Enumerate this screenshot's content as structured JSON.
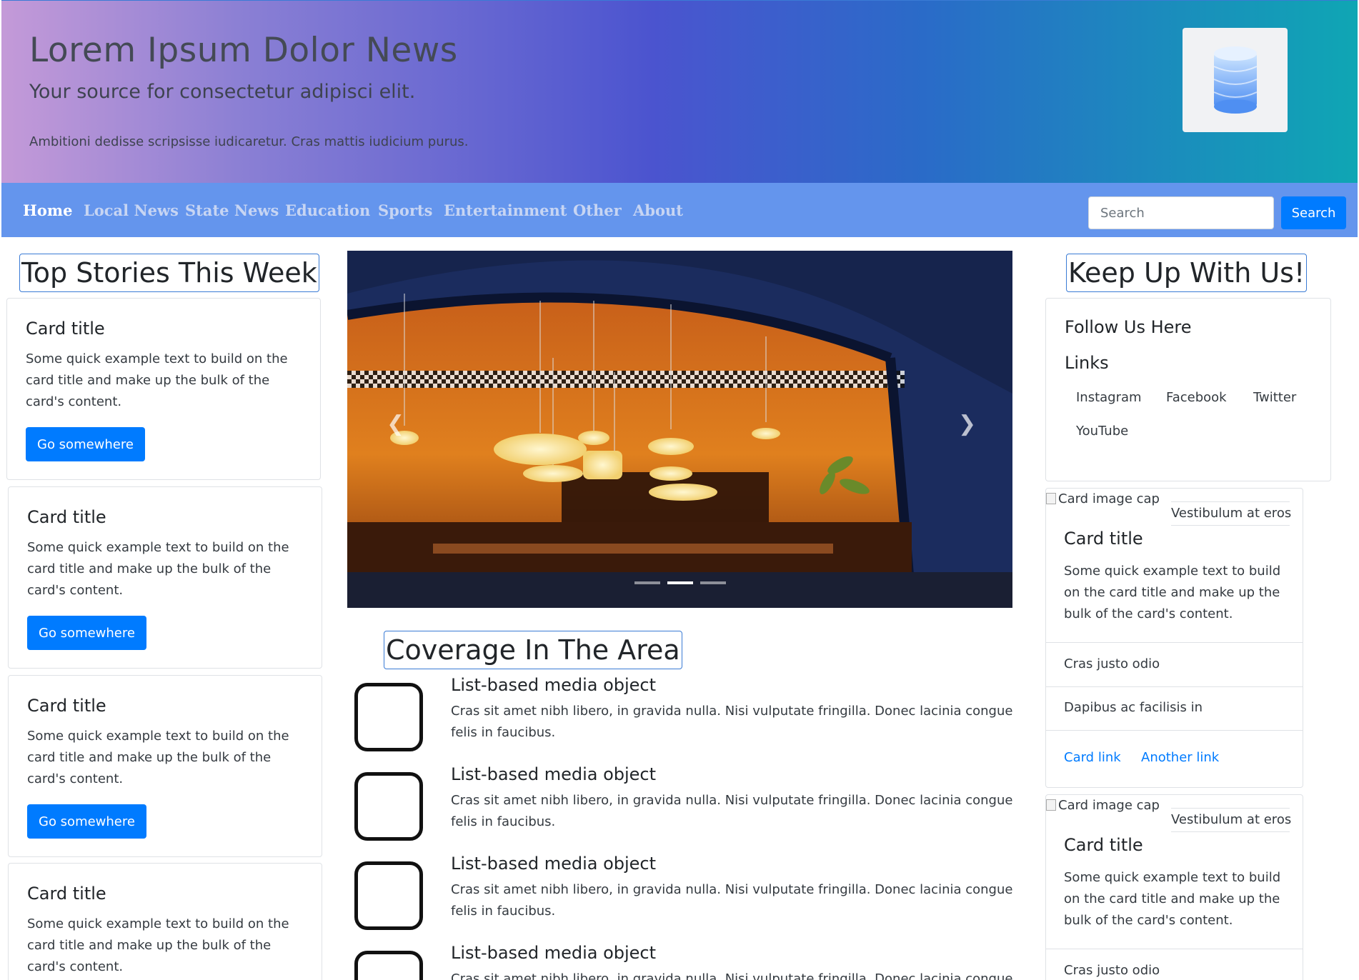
{
  "header": {
    "title": "Lorem Ipsum Dolor News",
    "subtitle": "Your source for consectetur adipisci elit.",
    "lead": "Ambitioni dedisse scripsisse iudicaretur. Cras mattis iudicium purus.",
    "logo_icon": "database-icon"
  },
  "nav": {
    "links": [
      "Home",
      "Local News",
      "State News",
      "Education",
      "Sports",
      "Entertainment",
      "Other",
      "About"
    ],
    "active": "Home",
    "search_placeholder": "Search",
    "search_button": "Search"
  },
  "left": {
    "heading": "Top Stories This Week",
    "cards": [
      {
        "title": "Card title",
        "text": "Some quick example text to build on the card title and make up the bulk of the card's content.",
        "button": "Go somewhere"
      },
      {
        "title": "Card title",
        "text": "Some quick example text to build on the card title and make up the bulk of the card's content.",
        "button": "Go somewhere"
      },
      {
        "title": "Card title",
        "text": "Some quick example text to build on the card title and make up the bulk of the card's content.",
        "button": "Go somewhere"
      },
      {
        "title": "Card title",
        "text": "Some quick example text to build on the card title and make up the bulk of the card's content."
      }
    ]
  },
  "center": {
    "carousel": {
      "slides": 3,
      "active_slide": 2
    },
    "heading": "Coverage In The Area",
    "media": [
      {
        "title": "List-based media object",
        "text": "Cras sit amet nibh libero, in gravida nulla. Nisi vulputate fringilla. Donec lacinia congue felis in faucibus."
      },
      {
        "title": "List-based media object",
        "text": "Cras sit amet nibh libero, in gravida nulla. Nisi vulputate fringilla. Donec lacinia congue felis in faucibus."
      },
      {
        "title": "List-based media object",
        "text": "Cras sit amet nibh libero, in gravida nulla. Nisi vulputate fringilla. Donec lacinia congue felis in faucibus."
      },
      {
        "title": "List-based media object",
        "text": "Cras sit amet nibh libero, in gravida nulla. Nisi vulputate fringilla. Donec lacinia congue felis in faucibus."
      }
    ]
  },
  "right": {
    "heading": "Keep Up With Us!",
    "follow_title": "Follow Us Here",
    "links_title": "Links",
    "social": [
      "Instagram",
      "Facebook",
      "Twitter",
      "YouTube"
    ],
    "image_cards": [
      {
        "img_alt": "Card image cap",
        "caption": "Vestibulum at eros",
        "title": "Card title",
        "text": "Some quick example text to build on the card title and make up the bulk of the card's content.",
        "items": [
          "Cras justo odio",
          "Dapibus ac facilisis in"
        ],
        "link1": "Card link",
        "link2": "Another link"
      },
      {
        "img_alt": "Card image cap",
        "caption": "Vestibulum at eros",
        "title": "Card title",
        "text": "Some quick example text to build on the card title and make up the bulk of the card's content.",
        "items": [
          "Cras justo odio"
        ]
      }
    ]
  }
}
